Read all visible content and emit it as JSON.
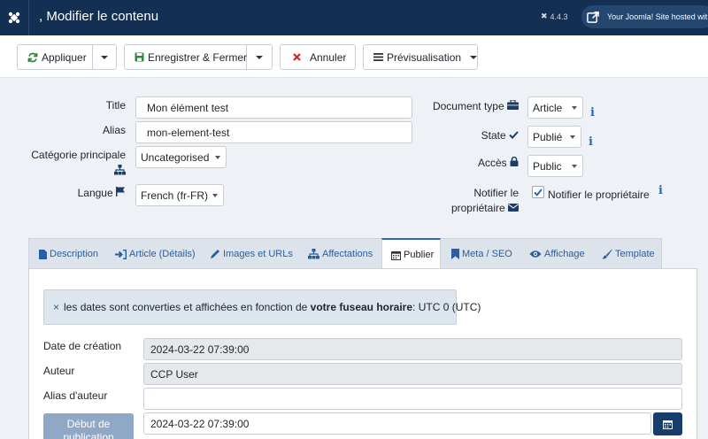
{
  "header": {
    "title": ", Modifier le contenu",
    "version": "4.4.3",
    "site_link": "Your Joomla! Site hosted wit..."
  },
  "toolbar": {
    "apply_label": "Appliquer",
    "save_close_label": "Enregistrer & Fermer",
    "cancel_label": "Annuler",
    "preview_label": "Prévisualisation"
  },
  "form": {
    "title_label": "Title",
    "title_value": "Mon élément test",
    "alias_label": "Alias",
    "alias_value": "mon-element-test",
    "category_label": "Catégorie principale",
    "category_value": "Uncategorised",
    "language_label": "Langue",
    "language_value": "French (fr-FR)",
    "doctype_label": "Document type",
    "doctype_value": "Article",
    "state_label": "State",
    "state_value": "Publié",
    "access_label": "Accès",
    "access_value": "Public",
    "notify_label_line1": "Notifier le",
    "notify_label_line2": "propriétaire",
    "notify_checkbox_label": "Notifier le propriétaire",
    "notify_checked": true
  },
  "tabs": [
    {
      "label": "Description"
    },
    {
      "label": "Article (Détails)"
    },
    {
      "label": "Images et URLs"
    },
    {
      "label": "Affectations"
    },
    {
      "label": "Publier"
    },
    {
      "label": "Meta / SEO"
    },
    {
      "label": "Affichage"
    },
    {
      "label": "Template"
    }
  ],
  "publish": {
    "alert_close": "×",
    "alert_text_before": "les dates sont converties et affichées en fonction de",
    "alert_text_bold": "votre fuseau horaire",
    "alert_text_after": ": UTC 0 (UTC)",
    "created_label": "Date de création",
    "created_value": "2024-03-22 07:39:00",
    "author_label": "Auteur",
    "author_value": "CCP User",
    "author_alias_label": "Alias d'auteur",
    "author_alias_value": "",
    "publish_up_label_line1": "Début de",
    "publish_up_label_line2": "publication",
    "publish_up_value": "2024-03-22 07:39:00"
  },
  "colors": {
    "header_bg": "#132f53",
    "accent": "#2a69b8",
    "link": "#2b5da3",
    "cancel_red": "#c52827",
    "apply_green": "#2f8a3c"
  }
}
